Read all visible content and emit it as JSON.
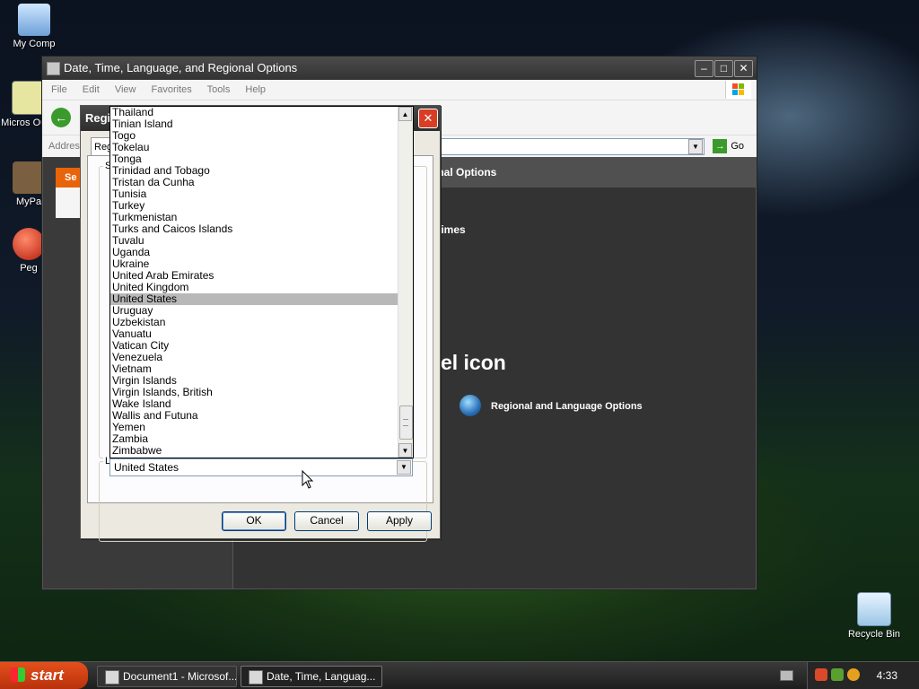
{
  "desktop": {
    "icons": [
      {
        "label": "My Comp"
      },
      {
        "label": "Micros Outlo"
      },
      {
        "label": "MyPa"
      },
      {
        "label": "Peg"
      },
      {
        "label": "Recycle Bin"
      }
    ]
  },
  "main_window": {
    "title": "Date, Time, Language, and Regional Options",
    "menu": [
      "File",
      "Edit",
      "View",
      "Favorites",
      "Tools",
      "Help"
    ],
    "address_label": "Addres",
    "go_label": "Go",
    "task_header": "Se",
    "banner_text": "onal Options",
    "subtitle_fragment": "ates, and times",
    "heading_fragment": "l Panel icon",
    "link_label": "Regional and Language Options"
  },
  "dialog": {
    "title": "Regi",
    "tab_label": "Reg",
    "group1_letter": "S",
    "group2_letter": "L",
    "selected_value": "United States",
    "buttons": {
      "ok": "OK",
      "cancel": "Cancel",
      "apply": "Apply"
    }
  },
  "dropdown": {
    "items": [
      "Thailand",
      "Tinian Island",
      "Togo",
      "Tokelau",
      "Tonga",
      "Trinidad and Tobago",
      "Tristan da Cunha",
      "Tunisia",
      "Turkey",
      "Turkmenistan",
      "Turks and Caicos Islands",
      "Tuvalu",
      "Uganda",
      "Ukraine",
      "United Arab Emirates",
      "United Kingdom",
      "United States",
      "Uruguay",
      "Uzbekistan",
      "Vanuatu",
      "Vatican City",
      "Venezuela",
      "Vietnam",
      "Virgin Islands",
      "Virgin Islands, British",
      "Wake Island",
      "Wallis and Futuna",
      "Yemen",
      "Zambia",
      "Zimbabwe"
    ],
    "selected_index": 16
  },
  "taskbar": {
    "start_label": "start",
    "tasks": [
      {
        "label": "Document1 - Microsof..."
      },
      {
        "label": "Date, Time, Languag..."
      }
    ],
    "clock": "4:33"
  },
  "icons": {
    "back": "back-arrow-icon",
    "go": "go-arrow-icon",
    "close": "close-icon",
    "globe": "globe-icon"
  },
  "colors": {
    "start_button": "#d2471a",
    "task_header": "#e8640a",
    "selection": "#b8b8b8"
  }
}
